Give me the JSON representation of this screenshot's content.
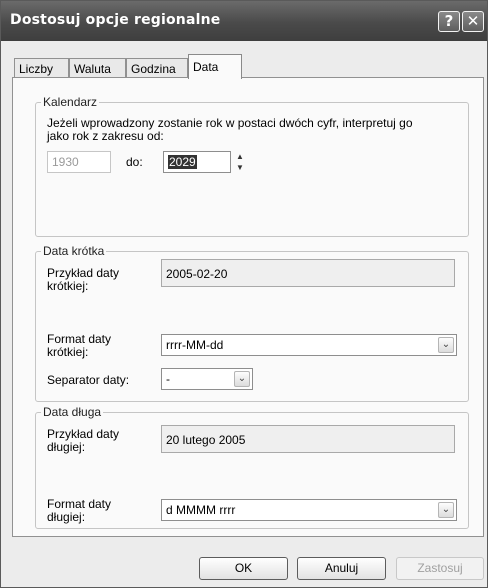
{
  "window": {
    "title": "Dostosuj opcje regionalne",
    "help_glyph": "?",
    "close_glyph": "✕"
  },
  "tabs": [
    {
      "label": "Liczby"
    },
    {
      "label": "Waluta"
    },
    {
      "label": "Godzina"
    },
    {
      "label": "Data"
    }
  ],
  "calendar": {
    "legend": "Kalendarz",
    "desc_line1": "Jeżeli wprowadzony zostanie rok w postaci dwóch cyfr, interpretuj go",
    "desc_line2": "jako rok z zakresu od:",
    "from_year": "1930",
    "to_label": "do:",
    "to_year": "2029",
    "spin_up": "▲",
    "spin_down": "▼"
  },
  "short_date": {
    "legend": "Data krótka",
    "example_label_1": "Przykład daty",
    "example_label_2": "krótkiej:",
    "example_value": "2005-02-20",
    "format_label_1": "Format daty",
    "format_label_2": "krótkiej:",
    "format_value": "rrrr-MM-dd",
    "separator_label": "Separator daty:",
    "separator_value": "-"
  },
  "long_date": {
    "legend": "Data długa",
    "example_label_1": "Przykład daty",
    "example_label_2": "długiej:",
    "example_value": "20 lutego 2005",
    "format_label_1": "Format daty",
    "format_label_2": "długiej:",
    "format_value": "d MMMM rrrr"
  },
  "buttons": {
    "ok": "OK",
    "cancel": "Anuluj",
    "apply": "Zastosuj"
  },
  "icons": {
    "dropdown": "chevron-down-icon"
  }
}
